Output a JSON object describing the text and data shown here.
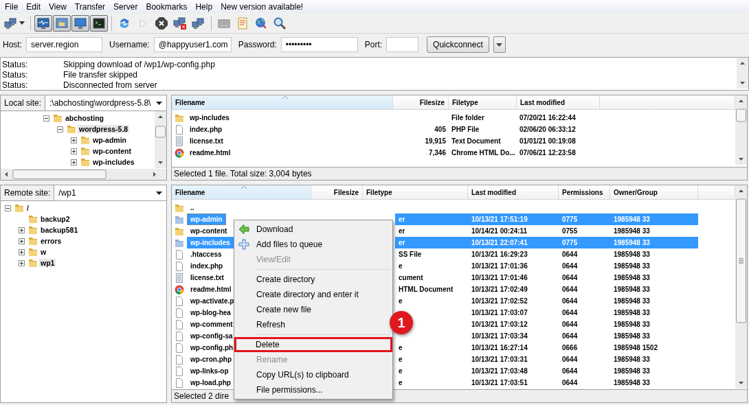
{
  "menu_bar": [
    "File",
    "Edit",
    "View",
    "Transfer",
    "Server",
    "Bookmarks",
    "Help",
    "New version available!"
  ],
  "toolbar": [
    {
      "pressed": false,
      "disabled": false
    },
    {
      "pressed": true,
      "disabled": false
    },
    {
      "pressed": true,
      "disabled": false
    },
    {
      "pressed": true,
      "disabled": false
    },
    {
      "pressed": true,
      "disabled": false
    },
    {
      "pressed": false,
      "disabled": false
    },
    {
      "pressed": false,
      "disabled": true
    },
    {
      "pressed": false,
      "disabled": false
    },
    {
      "pressed": false,
      "disabled": false
    },
    {
      "pressed": false,
      "disabled": false
    },
    {
      "pressed": false,
      "disabled": false
    },
    {
      "pressed": false,
      "disabled": false
    },
    {
      "pressed": false,
      "disabled": false
    },
    {
      "pressed": false,
      "disabled": false
    }
  ],
  "quickconnect": {
    "host_label": "Host:",
    "host": "server.region",
    "username_label": "Username:",
    "username": "@happyuser1.com",
    "password_label": "Password:",
    "password": "•••••••••",
    "port_label": "Port:",
    "button": "Quickconnect"
  },
  "log": [
    {
      "label": "Status:",
      "message": "Skipping download of /wp1/wp-config.php"
    },
    {
      "label": "Status:",
      "message": "File transfer skipped"
    },
    {
      "label": "Status:",
      "message": "Disconnected from server"
    }
  ],
  "local": {
    "site_label": "Local site:",
    "path": ":\\abchosting\\wordpress-5.8\\",
    "tree": [
      {
        "name": "abchosting",
        "has_children": true,
        "expanded": true,
        "selected": false,
        "children": [
          {
            "name": "wordpress-5.8",
            "has_children": true,
            "expanded": true,
            "selected": true,
            "children": [
              {
                "name": "wp-admin",
                "has_children": true,
                "expanded": false,
                "selected": false
              },
              {
                "name": "wp-content",
                "has_children": true,
                "expanded": false,
                "selected": false
              },
              {
                "name": "wp-includes",
                "has_children": true,
                "expanded": false,
                "selected": false
              }
            ]
          }
        ]
      }
    ],
    "columns": [
      "Filename",
      "Filesize",
      "Filetype",
      "Last modified"
    ],
    "rows": [
      {
        "kind": "folder",
        "name": "wp-includes",
        "type": "File folder",
        "modified": "07/20/21 16:22:44"
      },
      {
        "kind": "file",
        "name": "index.php",
        "size": "405",
        "type": "PHP File",
        "modified": "02/06/20 06:33:12"
      },
      {
        "kind": "text",
        "name": "license.txt",
        "size": "19,915",
        "type": "Text Document",
        "modified": "01/01/21 00:19:08"
      },
      {
        "kind": "html",
        "name": "readme.html",
        "size": "7,346",
        "type": "Chrome HTML Do...",
        "modified": "07/06/21 12:23:58"
      }
    ],
    "status": "Selected 1 file. Total size: 3,004 bytes"
  },
  "remote": {
    "site_label": "Remote site:",
    "path": "/wp1",
    "tree": [
      {
        "name": "/",
        "has_children": true,
        "expanded": true,
        "selected": false,
        "children": [
          {
            "name": "backup2",
            "has_children": false,
            "expanded": false,
            "selected": false
          },
          {
            "name": "backup581",
            "has_children": true,
            "expanded": false,
            "selected": false
          },
          {
            "name": "errors",
            "has_children": true,
            "expanded": false,
            "selected": false
          },
          {
            "name": "w",
            "has_children": true,
            "expanded": false,
            "selected": false
          },
          {
            "name": "wp1",
            "has_children": true,
            "expanded": false,
            "selected": true
          }
        ]
      }
    ],
    "columns": [
      "Filename",
      "Filesize",
      "Filetype",
      "Last modified",
      "Permissions",
      "Owner/Group"
    ],
    "rows": [
      {
        "kind": "folder",
        "name": "..",
        "selected": false,
        "focused": false
      },
      {
        "kind": "folder",
        "name": "wp-admin",
        "type": "er",
        "modified": "10/13/21 17:51:19",
        "permissions": "0775",
        "owner": "1985948 33",
        "selected": true,
        "focused": true
      },
      {
        "kind": "folder",
        "name": "wp-content",
        "type": "er",
        "modified": "10/14/21 00:24:11",
        "permissions": "0755",
        "owner": "1985948 33",
        "selected": false,
        "focused": false
      },
      {
        "kind": "folder",
        "name": "wp-includes",
        "type": "er",
        "modified": "10/13/21 22:07:41",
        "permissions": "0775",
        "owner": "1985948 33",
        "selected": true,
        "focused": false
      },
      {
        "kind": "file",
        "name": ".htaccess",
        "type": "SS File",
        "modified": "10/13/21 16:29:23",
        "permissions": "0644",
        "owner": "1985948 33",
        "selected": false,
        "focused": false
      },
      {
        "kind": "file",
        "name": "index.php",
        "type": "e",
        "modified": "10/13/21 17:01:36",
        "permissions": "0644",
        "owner": "1985948 33",
        "selected": false,
        "focused": false
      },
      {
        "kind": "text",
        "name": "license.txt",
        "type": "cument",
        "modified": "10/13/21 17:01:46",
        "permissions": "0644",
        "owner": "1985948 33",
        "selected": false,
        "focused": false
      },
      {
        "kind": "html",
        "name": "readme.html",
        "type": "HTML Document",
        "modified": "10/13/21 17:02:49",
        "permissions": "0644",
        "owner": "1985948 33",
        "selected": false,
        "focused": false
      },
      {
        "kind": "file",
        "name": "wp-activate.p",
        "type": "e",
        "modified": "10/13/21 17:02:52",
        "permissions": "0644",
        "owner": "1985948 33",
        "selected": false,
        "focused": false
      },
      {
        "kind": "file",
        "name": "wp-blog-hea",
        "modified": "10/13/21 17:03:07",
        "permissions": "0644",
        "owner": "1985948 33",
        "selected": false,
        "focused": false
      },
      {
        "kind": "file",
        "name": "wp-comment",
        "modified": "10/13/21 17:03:12",
        "permissions": "0644",
        "owner": "1985948 33",
        "selected": false,
        "focused": false
      },
      {
        "kind": "file",
        "name": "wp-config-sa",
        "modified": "10/13/21 17:03:34",
        "permissions": "0644",
        "owner": "1985948 33",
        "selected": false,
        "focused": false
      },
      {
        "kind": "file",
        "name": "wp-config.ph",
        "type": "e",
        "modified": "10/13/21 16:27:14",
        "permissions": "0666",
        "owner": "1985948 1502",
        "selected": false,
        "focused": false
      },
      {
        "kind": "file",
        "name": "wp-cron.php",
        "type": "e",
        "modified": "10/13/21 17:03:31",
        "permissions": "0644",
        "owner": "1985948 33",
        "selected": false,
        "focused": false
      },
      {
        "kind": "file",
        "name": "wp-links-op",
        "type": "e",
        "modified": "10/13/21 17:03:48",
        "permissions": "0644",
        "owner": "1985948 33",
        "selected": false,
        "focused": false
      },
      {
        "kind": "file",
        "name": "wp-load.php",
        "type": "e",
        "modified": "10/13/21 17:03:51",
        "permissions": "0644",
        "owner": "1985948 33",
        "selected": false,
        "focused": false
      }
    ],
    "status": "Selected 2 dire"
  },
  "context_menu": [
    [
      {
        "label": "Download",
        "disabled": false,
        "highlighted": false
      },
      {
        "label": "Add files to queue",
        "disabled": false,
        "highlighted": false
      },
      {
        "label": "View/Edit",
        "disabled": true,
        "highlighted": false
      }
    ],
    [
      {
        "label": "Create directory",
        "disabled": false,
        "highlighted": false
      },
      {
        "label": "Create directory and enter it",
        "disabled": false,
        "highlighted": false
      },
      {
        "label": "Create new file",
        "disabled": false,
        "highlighted": false
      },
      {
        "label": "Refresh",
        "disabled": false,
        "highlighted": false
      }
    ],
    [
      {
        "label": "Delete",
        "disabled": false,
        "highlighted": true
      },
      {
        "label": "Rename",
        "disabled": true,
        "highlighted": false
      },
      {
        "label": "Copy URL(s) to clipboard",
        "disabled": false,
        "highlighted": false
      },
      {
        "label": "File permissions...",
        "disabled": false,
        "highlighted": false
      }
    ]
  ],
  "callout": "1"
}
